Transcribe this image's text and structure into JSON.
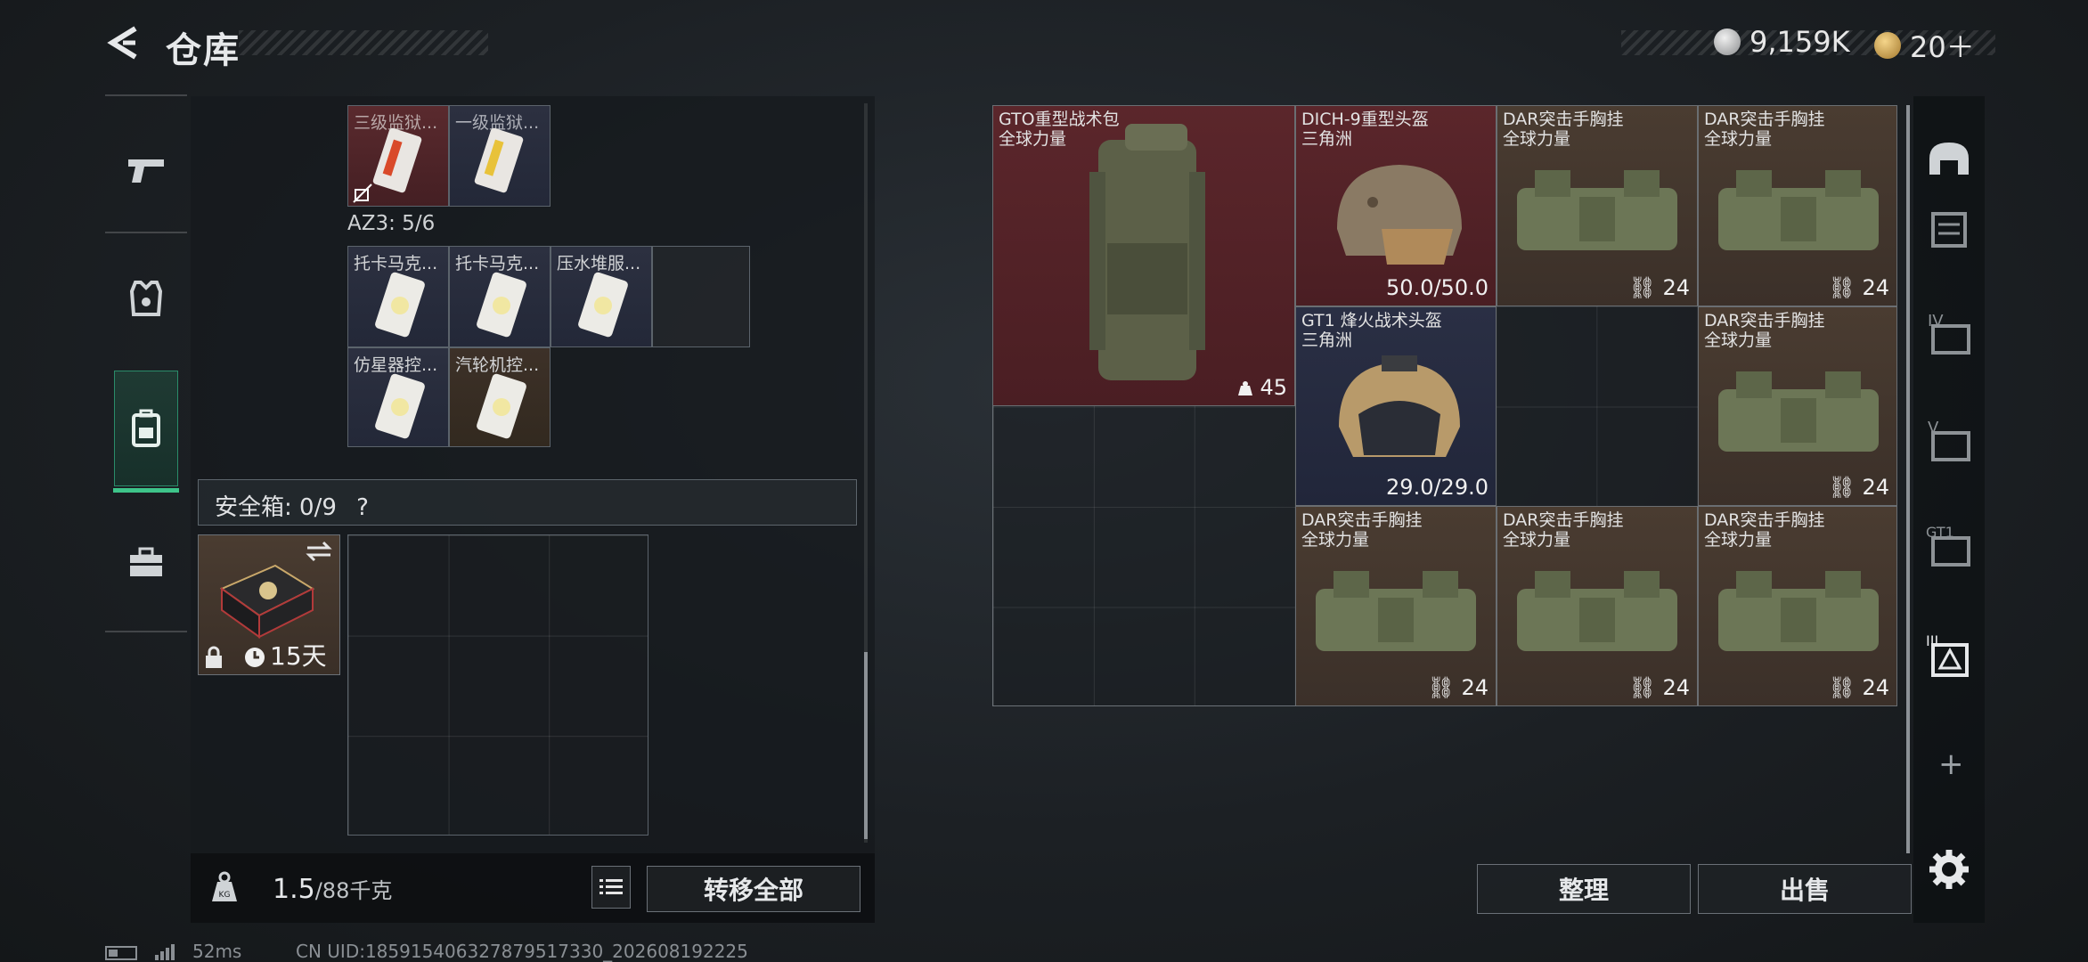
{
  "header": {
    "title": "仓库",
    "currency1": "9,159K",
    "currency2": "20＋"
  },
  "nav": [
    "pistol-icon",
    "armor-vest-icon",
    "backpack-icon",
    "toolbox-icon"
  ],
  "left": {
    "row1": [
      {
        "name": "三级监狱..."
      },
      {
        "name": "一级监狱..."
      }
    ],
    "az3_label": "AZ3: 5/6",
    "row2": [
      {
        "name": "托卡马克..."
      },
      {
        "name": "托卡马克..."
      },
      {
        "name": "压水堆服..."
      }
    ],
    "row3": [
      {
        "name": "仿星器控..."
      },
      {
        "name": "汽轮机控..."
      }
    ],
    "safe_label": "安全箱: 0/9",
    "safe_help": "?",
    "safe_days": "15天",
    "weight_value": "1.5",
    "weight_total": "/88千克",
    "transfer_all": "转移全部"
  },
  "right": {
    "items": [
      {
        "name": "GTO重型战术包",
        "sub": "全球力量",
        "count": "45"
      },
      {
        "name": "DICH-9重型头盔",
        "sub": "三角洲",
        "count": "50.0/50.0"
      },
      {
        "name": "DAR突击手胸挂",
        "sub": "全球力量",
        "count": "24"
      },
      {
        "name": "DAR突击手胸挂",
        "sub": "全球力量",
        "count": "24"
      },
      {
        "name": "GT1 烽火战术头盔",
        "sub": "三角洲",
        "count": "29.0/29.0"
      },
      {
        "name": "DAR突击手胸挂",
        "sub": "全球力量",
        "count": "24"
      },
      {
        "name": "DAR突击手胸挂",
        "sub": "全球力量",
        "count": "24"
      },
      {
        "name": "DAR突击手胸挂",
        "sub": "全球力量",
        "count": "24"
      },
      {
        "name": "DAR突击手胸挂",
        "sub": "全球力量",
        "count": "24"
      }
    ],
    "sort": "整理",
    "sell": "出售"
  },
  "rightbar": [
    "helmet-slot-icon",
    "armor-slot-icon",
    "IV",
    "V",
    "GT1",
    "III",
    "+",
    "gear-icon"
  ],
  "footer": {
    "ping": "52ms",
    "uid": "CN UID:185915406327879517330_202608192225"
  }
}
